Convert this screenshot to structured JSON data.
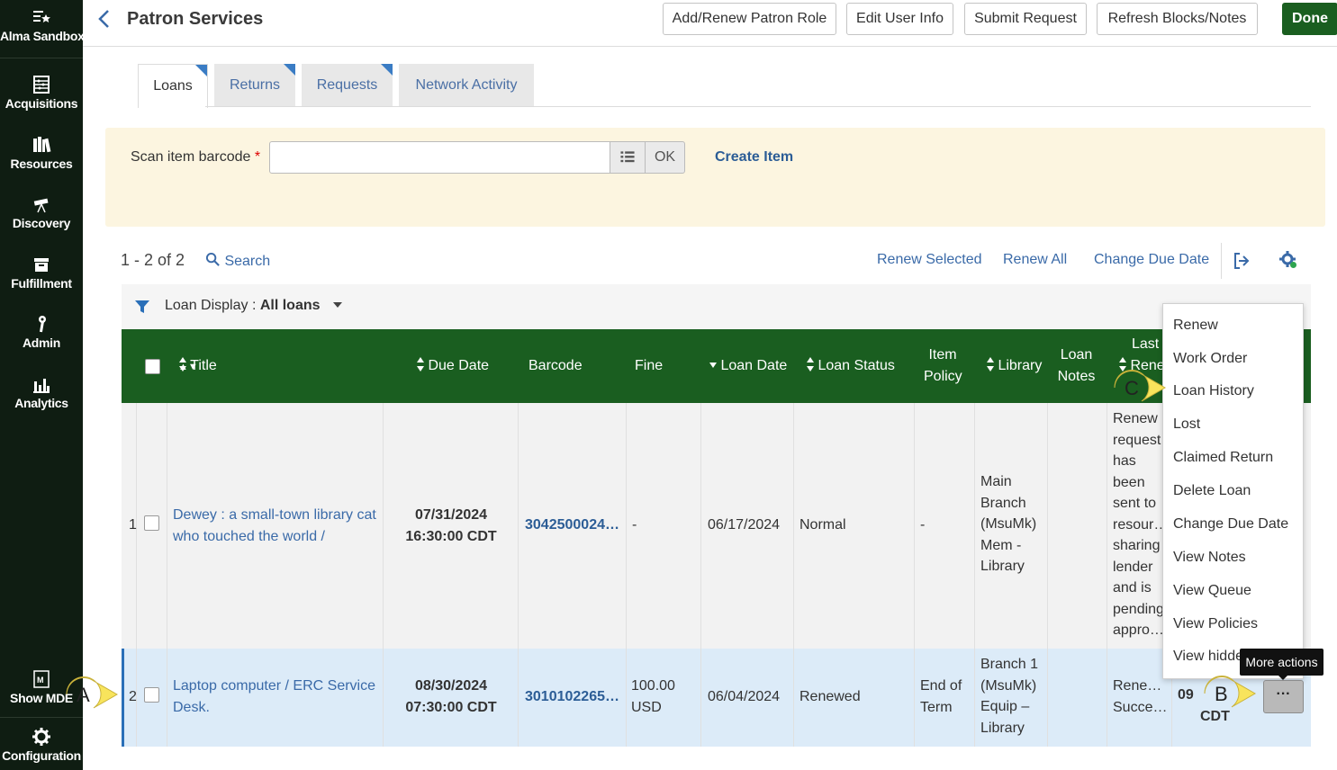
{
  "app": {
    "instance_label": "Alma Sandbox"
  },
  "nav": {
    "items": [
      {
        "label": "Alma Sandbox",
        "icon": "list-star-icon"
      },
      {
        "label": "Acquisitions",
        "icon": "abacus-icon"
      },
      {
        "label": "Resources",
        "icon": "books-icon"
      },
      {
        "label": "Discovery",
        "icon": "telescope-icon"
      },
      {
        "label": "Fulfillment",
        "icon": "box-icon"
      },
      {
        "label": "Admin",
        "icon": "wrench-icon"
      },
      {
        "label": "Analytics",
        "icon": "bar-chart-icon"
      }
    ],
    "bottom_items": [
      {
        "label": "Show MDE",
        "icon": "mde-icon"
      },
      {
        "label": "Configuration",
        "icon": "gear-icon"
      }
    ]
  },
  "header": {
    "title": "Patron Services",
    "buttons": {
      "add_renew_role": "Add/Renew Patron Role",
      "edit_user_info": "Edit User Info",
      "submit_request": "Submit Request",
      "refresh_blocks": "Refresh Blocks/Notes",
      "done": "Done"
    }
  },
  "tabs": [
    {
      "label": "Loans",
      "active": true
    },
    {
      "label": "Returns",
      "active": false
    },
    {
      "label": "Requests",
      "active": false
    },
    {
      "label": "Network Activity",
      "active": false
    }
  ],
  "scan": {
    "label": "Scan item barcode",
    "required_marker": "*",
    "input_value": "",
    "ok_label": "OK",
    "create_item": "Create Item"
  },
  "toolbar": {
    "count": "1 - 2 of 2",
    "search": "Search",
    "renew_selected": "Renew Selected",
    "renew_all": "Renew All",
    "change_due_date": "Change Due Date"
  },
  "filter": {
    "label": "Loan Display :",
    "value": "All loans"
  },
  "table": {
    "columns": {
      "title": "Title",
      "due_date": "Due Date",
      "barcode": "Barcode",
      "fine": "Fine",
      "loan_date": "Loan Date",
      "loan_status": "Loan Status",
      "item_policy_1": "Item",
      "item_policy_2": "Policy",
      "library": "Library",
      "loan_notes_1": "Loan",
      "loan_notes_2": "Notes",
      "last_renew_1": "Last",
      "last_renew_2": "Rene"
    },
    "rows": [
      {
        "index": "1",
        "title_l1": "Dewey : a small-town library cat",
        "title_l2": "who touched the world /",
        "due_l1": "07/31/2024",
        "due_l2": "16:30:00 CDT",
        "barcode": "3042500024…",
        "fine": "-",
        "loan_date": "06/17/2024",
        "loan_status": "Normal",
        "item_policy": "-",
        "library": [
          "Main",
          "Branch",
          "(MsuMk)",
          "Mem -",
          "Library"
        ],
        "last_renew": [
          "Renew",
          "request",
          "has",
          "been",
          "sent to",
          "resour…",
          "sharing",
          "lender",
          "and is",
          "pending",
          "appro…"
        ]
      },
      {
        "index": "2",
        "title_l1": "Laptop computer / ERC Service",
        "title_l2": "Desk.",
        "due_l1": "08/30/2024",
        "due_l2": "07:30:00 CDT",
        "barcode": "3010102265…",
        "fine_l1": "100.00",
        "fine_l2": "USD",
        "loan_date": "06/04/2024",
        "loan_status": "Renewed",
        "item_policy_l1": "End of",
        "item_policy_l2": "Term",
        "library": [
          "Branch 1",
          "(MsuMk)",
          "Equip –",
          "Library"
        ],
        "last_renew_l1": "Rene…",
        "last_renew_l2": "Succe…",
        "partial_l1": "09",
        "partial_l2": "CDT"
      }
    ]
  },
  "menu": {
    "items": [
      "Renew",
      "Work Order",
      "Loan History",
      "Lost",
      "Claimed Return",
      "Delete Loan",
      "Change Due Date",
      "View Notes",
      "View Queue",
      "View Policies",
      "View hidde"
    ]
  },
  "more_actions": {
    "label": "···",
    "tooltip": "More actions"
  },
  "callouts": {
    "a": "A",
    "b": "B",
    "c": "C"
  },
  "colors": {
    "nav_bg": "#0f1d12",
    "header_green": "#1a5e20",
    "link_blue": "#3a6aa8",
    "scan_bg": "#fcf5e0",
    "callout_yellow": "#f8e45c"
  }
}
